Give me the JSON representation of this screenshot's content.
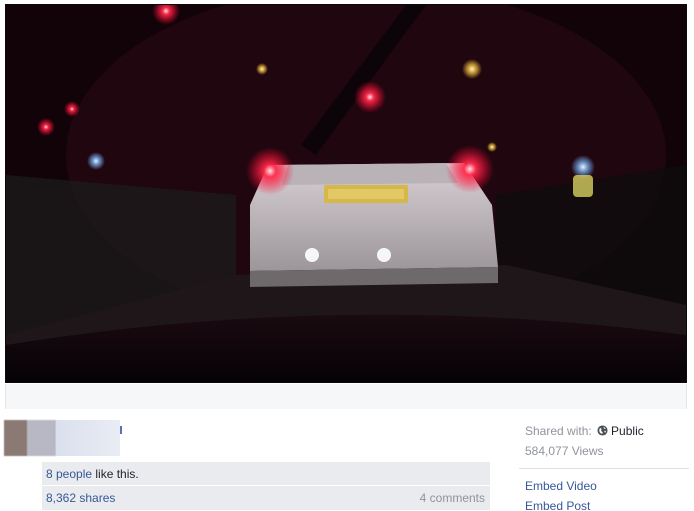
{
  "likes": {
    "count_text": "8 people",
    "suffix_text": " like this."
  },
  "stats": {
    "shares": "8,362 shares",
    "comments": "4 comments"
  },
  "sidebar": {
    "shared_with_label": "Shared with:",
    "audience": "Public",
    "audience_icon": "globe-icon",
    "views": "584,077 Views",
    "embed_video": "Embed Video",
    "embed_post": "Embed Post"
  },
  "colors": {
    "link": "#365899",
    "muted": "#90949c",
    "panel": "#e9ebee"
  }
}
